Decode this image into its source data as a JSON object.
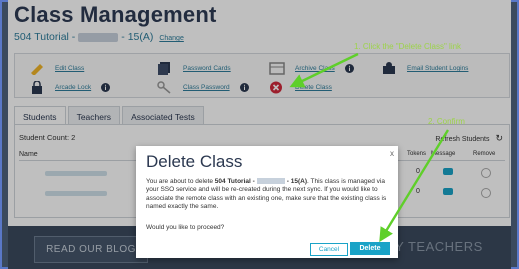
{
  "page": {
    "title": "Class Management",
    "subtitle_prefix": "504 Tutorial -",
    "subtitle_suffix": "- 15(A)",
    "change_link": "Change"
  },
  "actions": [
    {
      "label": "Edit Class",
      "icon": "pencil-icon"
    },
    {
      "label": "Password Cards",
      "icon": "cards-icon"
    },
    {
      "label": "Archive Class",
      "icon": "archive-icon"
    },
    {
      "label": "Email Student Logins",
      "icon": "email-user-icon"
    },
    {
      "label": "Arcade Lock",
      "icon": "lock-icon"
    },
    {
      "label": "Class Password",
      "icon": "key-icon"
    },
    {
      "label": "Delete Class",
      "icon": "delete-circle-icon"
    }
  ],
  "callouts": {
    "step1": "1. Click the \"Delete Class\" link",
    "step2": "2. Confirm"
  },
  "tabs": [
    "Students",
    "Teachers",
    "Associated Tests"
  ],
  "students": {
    "count_label": "Student Count: 2",
    "name_header": "Name",
    "refresh_label": "Refresh Students",
    "col_tokens": "Tokens",
    "col_message": "Message",
    "col_remove": "Remove",
    "rows": [
      {
        "tokens": "0"
      },
      {
        "tokens": "0"
      }
    ]
  },
  "footer": {
    "blog": "READ OUR BLOG",
    "tagline": "BY TEACHERS"
  },
  "modal": {
    "title": "Delete Class",
    "body_before": "You are about to delete",
    "body_class_prefix": "504 Tutorial -",
    "body_class_suffix": "- 15(A)",
    "body_after": ". This class is managed via your SSO service and will be re-created during the next sync. If you would like to associate the remote class with an existing one, make sure that the existing class is named exactly the same.",
    "question": "Would you like to proceed?",
    "cancel": "Cancel",
    "delete": "Delete",
    "close": "x"
  },
  "colors": {
    "accent": "#1aa3c7",
    "arrow": "#5fcf2a",
    "footer": "#3b4a5e",
    "title": "#2e3b55"
  }
}
